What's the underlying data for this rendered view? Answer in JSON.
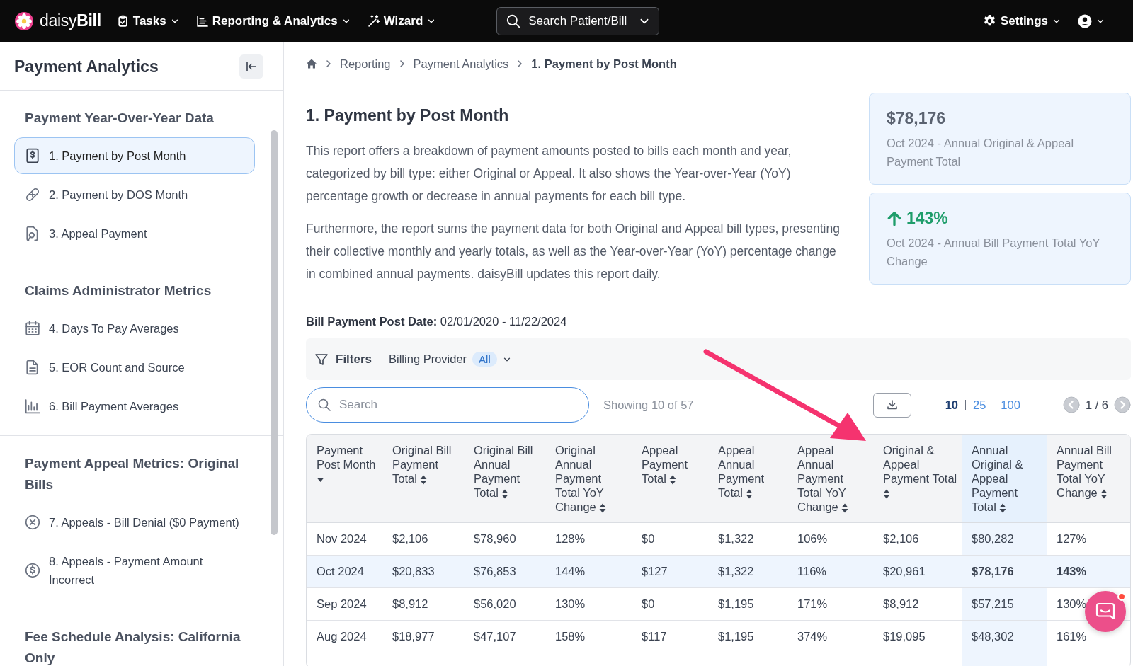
{
  "topbar": {
    "logo": "daisy**Bill**",
    "nav": [
      {
        "label": "Tasks"
      },
      {
        "label": "Reporting & Analytics"
      },
      {
        "label": "Wizard"
      }
    ],
    "search": "Search Patient/Bill",
    "settings": "Settings"
  },
  "sidebar": {
    "title": "Payment Analytics",
    "sections": [
      {
        "title": "Payment Year-Over-Year Data",
        "items": [
          {
            "label": "1. Payment by Post Month",
            "selected": true
          },
          {
            "label": "2. Payment by DOS Month",
            "selected": false
          },
          {
            "label": "3. Appeal Payment",
            "selected": false
          }
        ]
      },
      {
        "title": "Claims Administrator Metrics",
        "items": [
          {
            "label": "4. Days To Pay Averages",
            "selected": false
          },
          {
            "label": "5. EOR Count and Source",
            "selected": false
          },
          {
            "label": "6. Bill Payment Averages",
            "selected": false
          }
        ]
      },
      {
        "title": "Payment Appeal Metrics: Original Bills",
        "items": [
          {
            "label": "7. Appeals - Bill Denial ($0 Payment)",
            "selected": false
          },
          {
            "label": "8. Appeals - Payment Amount Incorrect",
            "selected": false
          }
        ]
      },
      {
        "title": "Fee Schedule Analysis: California Only"
      }
    ]
  },
  "breadcrumb": [
    "Reporting",
    "Payment Analytics",
    "1. Payment by Post Month"
  ],
  "report": {
    "title": "1. Payment by Post Month",
    "paragraphs": [
      "This report offers a breakdown of payment amounts posted to bills each month and year, categorized by bill type: either Original or Appeal. It also shows the Year-over-Year (YoY) percentage growth or decrease in annual payments for each bill type.",
      "Furthermore, the report sums the payment data for both Original and Appeal bill types, presenting their collective monthly and yearly totals, as well as the Year-over-Year (YoY) percentage change in combined annual payments. daisyBill updates this report daily."
    ]
  },
  "stats": [
    {
      "value": "$78,176",
      "rising": false,
      "caption": "Oct 2024 - Annual Original & Appeal Payment Total"
    },
    {
      "value": "143%",
      "rising": true,
      "caption": "Oct 2024 - Annual Bill Payment Total YoY Change"
    }
  ],
  "date_range": "**Bill Payment Post Date:** 02/01/2020 - 11/22/2024",
  "filters": {
    "label": "Filters",
    "provider_label": "Billing Provider",
    "provider_value": "All"
  },
  "toolbar": {
    "search_placeholder": "Search",
    "showing": "Showing 10 of 57",
    "page_sizes": [
      {
        "label": "10",
        "selected": true
      },
      {
        "label": "25",
        "selected": false
      },
      {
        "label": "100",
        "selected": false
      }
    ],
    "pager": "1 / 6"
  },
  "table": {
    "columns": [
      {
        "label": "Payment Post Month",
        "sorted": true,
        "highlighted": false
      },
      {
        "label": "Original Bill Payment Total",
        "sorted": false,
        "highlighted": false
      },
      {
        "label": "Original Bill Annual Payment Total",
        "sorted": false,
        "highlighted": false
      },
      {
        "label": "Original Annual Payment Total YoY Change",
        "sorted": false,
        "highlighted": false
      },
      {
        "label": "Appeal Payment Total",
        "sorted": false,
        "highlighted": false
      },
      {
        "label": "Appeal Annual Payment Total",
        "sorted": false,
        "highlighted": false
      },
      {
        "label": "Appeal Annual Payment Total YoY Change",
        "sorted": false,
        "highlighted": false
      },
      {
        "label": "Original & Appeal Payment Total",
        "sorted": false,
        "highlighted": false
      },
      {
        "label": "Annual Original & Appeal Payment Total",
        "sorted": false,
        "highlighted": true
      },
      {
        "label": "Annual Bill Payment Total YoY Change",
        "sorted": false,
        "highlighted": false
      }
    ],
    "rows": [
      {
        "selected": false,
        "cells": [
          "Nov 2024",
          "$2,106",
          "$78,960",
          "128%",
          "$0",
          "$1,322",
          "106%",
          "$2,106",
          "$80,282",
          "127%"
        ]
      },
      {
        "selected": true,
        "cells": [
          "Oct 2024",
          "$20,833",
          "$76,853",
          "144%",
          "$127",
          "$1,322",
          "116%",
          "$20,961",
          "$78,176",
          "143%"
        ]
      },
      {
        "selected": false,
        "cells": [
          "Sep 2024",
          "$8,912",
          "$56,020",
          "130%",
          "$0",
          "$1,195",
          "171%",
          "$8,912",
          "$57,215",
          "130%"
        ]
      },
      {
        "selected": false,
        "cells": [
          "Aug 2024",
          "$18,977",
          "$47,107",
          "158%",
          "$117",
          "$1,195",
          "374%",
          "$19,095",
          "$48,302",
          "161%"
        ]
      }
    ]
  },
  "chat": {
    "unread": true
  }
}
